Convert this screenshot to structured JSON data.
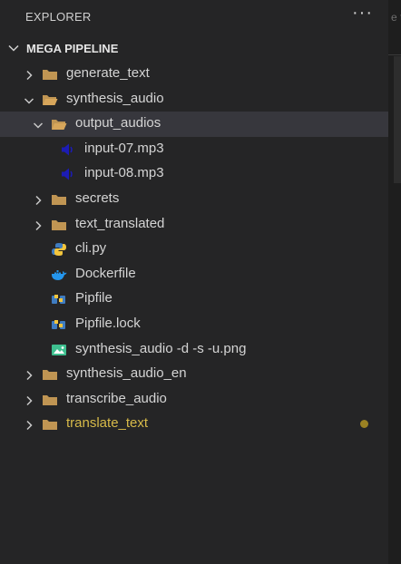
{
  "explorer": {
    "title": "EXPLORER",
    "more_icon": "more-actions-icon",
    "section": {
      "title": "MEGA PIPELINE",
      "expanded": true
    },
    "edge_tab_text": "e t"
  },
  "tree": [
    {
      "label": "generate_text",
      "type": "folder",
      "depth": 0,
      "expanded": false
    },
    {
      "label": "synthesis_audio",
      "type": "folder",
      "depth": 0,
      "expanded": true
    },
    {
      "label": "output_audios",
      "type": "folder",
      "depth": 1,
      "expanded": true,
      "selected": true
    },
    {
      "label": "input-07.mp3",
      "type": "audio",
      "depth": 2
    },
    {
      "label": "input-08.mp3",
      "type": "audio",
      "depth": 2
    },
    {
      "label": "secrets",
      "type": "folder",
      "depth": 1,
      "expanded": false
    },
    {
      "label": "text_translated",
      "type": "folder",
      "depth": 1,
      "expanded": false
    },
    {
      "label": "cli.py",
      "type": "python",
      "depth": 1
    },
    {
      "label": "Dockerfile",
      "type": "docker",
      "depth": 1
    },
    {
      "label": "Pipfile",
      "type": "pipfile",
      "depth": 1
    },
    {
      "label": "Pipfile.lock",
      "type": "pipfile",
      "depth": 1
    },
    {
      "label": "synthesis_audio -d -s -u.png",
      "type": "image",
      "depth": 1
    },
    {
      "label": "synthesis_audio_en",
      "type": "folder",
      "depth": 0,
      "expanded": false
    },
    {
      "label": "transcribe_audio",
      "type": "folder",
      "depth": 0,
      "expanded": false
    },
    {
      "label": "translate_text",
      "type": "folder",
      "depth": 0,
      "expanded": false,
      "git_modified": true
    }
  ],
  "colors": {
    "sidebar_bg": "#252526",
    "selection_bg": "#37373d",
    "folder": "#c09553",
    "audio": "#1c1cb4",
    "modified_text": "#d7ba49",
    "modified_dot": "#9b8223"
  }
}
